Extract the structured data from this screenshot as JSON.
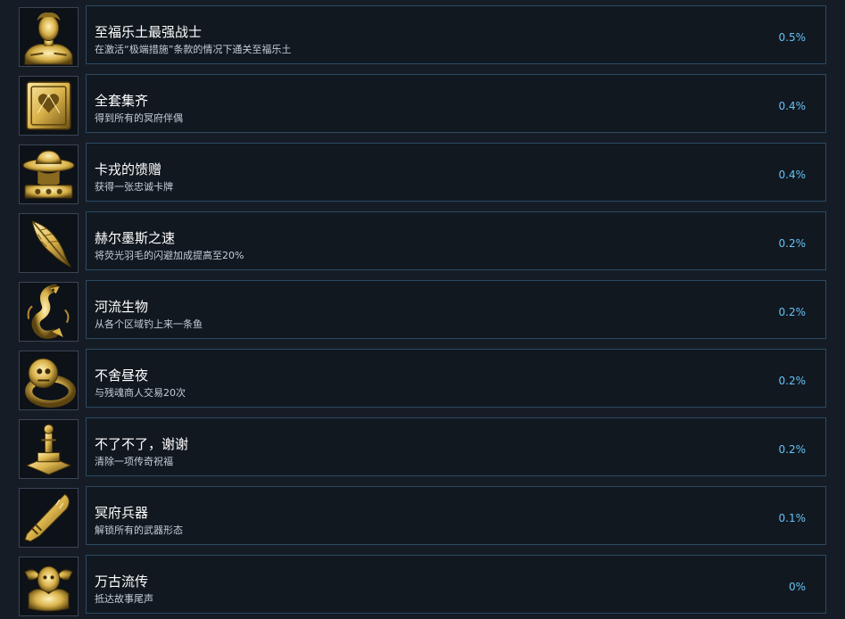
{
  "colors": {
    "background": "#161c25",
    "panel": "#111820",
    "panel_border": "#2b4a63",
    "title": "#ffffff",
    "description": "#c6cdd6",
    "percent": "#67c1f5",
    "gold": "#d9b24a"
  },
  "achievements": [
    {
      "icon": "bust-icon",
      "title": "至福乐土最强战士",
      "description": "在激活“极端措施”条款的情况下通关至福乐土",
      "percent": "0.5%"
    },
    {
      "icon": "card-icon",
      "title": "全套集齐",
      "description": "得到所有的冥府伴偶",
      "percent": "0.4%"
    },
    {
      "icon": "hat-icon",
      "title": "卡戎的馈赠",
      "description": "获得一张忠诚卡牌",
      "percent": "0.4%"
    },
    {
      "icon": "feather-icon",
      "title": "赫尔墨斯之速",
      "description": "将荧光羽毛的闪避加成提高至20%",
      "percent": "0.2%"
    },
    {
      "icon": "fish-icon",
      "title": "河流生物",
      "description": "从各个区域钓上来一条鱼",
      "percent": "0.2%"
    },
    {
      "icon": "ring-icon",
      "title": "不舍昼夜",
      "description": "与残魂商人交易20次",
      "percent": "0.2%"
    },
    {
      "icon": "statue-icon",
      "title": "不了不了，谢谢",
      "description": "清除一项传奇祝福",
      "percent": "0.2%"
    },
    {
      "icon": "weapon-icon",
      "title": "冥府兵器",
      "description": "解锁所有的武器形态",
      "percent": "0.1%"
    },
    {
      "icon": "crest-icon",
      "title": "万古流传",
      "description": "抵达故事尾声",
      "percent": "0%"
    }
  ]
}
